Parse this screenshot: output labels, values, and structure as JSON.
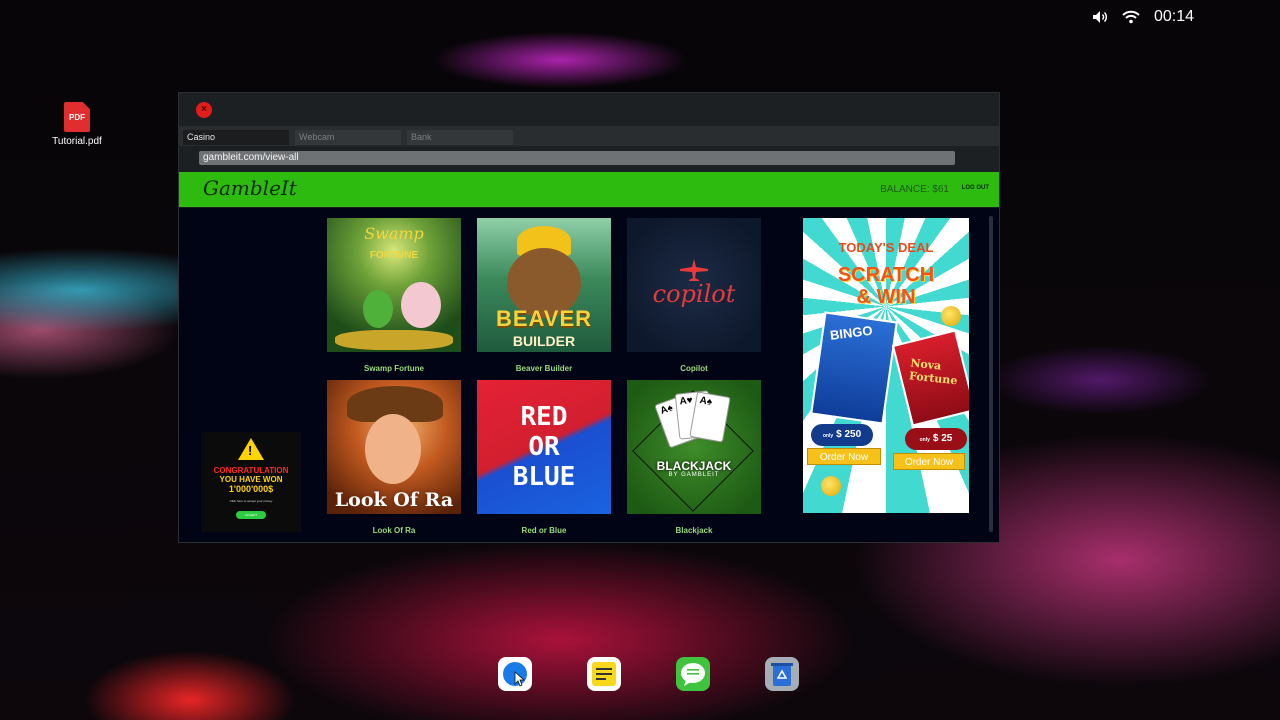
{
  "status_bar": {
    "time": "00:14",
    "volume_icon": "volume-icon",
    "wifi_icon": "wifi-icon"
  },
  "desktop": {
    "icons": [
      {
        "label": "Tutorial.pdf",
        "glyph": "PDF",
        "icon": "pdf-file-icon"
      }
    ]
  },
  "browser": {
    "tabs": [
      {
        "label": "Casino",
        "active": true
      },
      {
        "label": "Webcam",
        "active": false
      },
      {
        "label": "Bank",
        "active": false
      }
    ],
    "url": "gambleit.com/view-all"
  },
  "site": {
    "logo": "GambleIt",
    "balance": "BALANCE: $61",
    "logout": "LOG OUT",
    "games": [
      {
        "name": "Swamp Fortune",
        "art_title": "Swamp",
        "art_subtitle": "FORTUNE"
      },
      {
        "name": "Beaver Builder",
        "art_title": "BEAVER",
        "art_subtitle": "BUILDER"
      },
      {
        "name": "Copilot",
        "art_title": "copilot"
      },
      {
        "name": "Look Of Ra",
        "art_title": "Look Of Ra"
      },
      {
        "name": "Red or Blue",
        "art_lines": [
          "RED",
          "OR",
          "BLUE"
        ]
      },
      {
        "name": "Blackjack",
        "art_title": "BLACKJACK",
        "art_subtitle": "BY GAMBLEIT"
      }
    ],
    "popup_ad": {
      "line1": "CONGRATULATION",
      "line2": "YOU HAVE WON",
      "line3": "1'000'000$",
      "small_text": "Click here to accept your money",
      "button": "ACCEPT"
    },
    "side_ad": {
      "deal": "TODAY'S DEAL",
      "headline_1": "SCRATCH",
      "headline_2": "& WIN",
      "ticket_left": "BINGO",
      "ticket_right": "Nova Fortune",
      "price_left": "$ 250",
      "price_right": "$ 25",
      "price_prefix": "only",
      "order_label": "Order Now"
    }
  },
  "dock": [
    {
      "name": "browser",
      "icon": "globe-cursor-icon"
    },
    {
      "name": "notes",
      "icon": "notes-icon"
    },
    {
      "name": "messages",
      "icon": "chat-icon"
    },
    {
      "name": "recycle-bin",
      "icon": "recycle-icon"
    }
  ],
  "colors": {
    "header_green": "#2dbb0f",
    "game_label": "#9ad97a",
    "site_bg": "#010414",
    "close_red": "#e21b1b"
  }
}
